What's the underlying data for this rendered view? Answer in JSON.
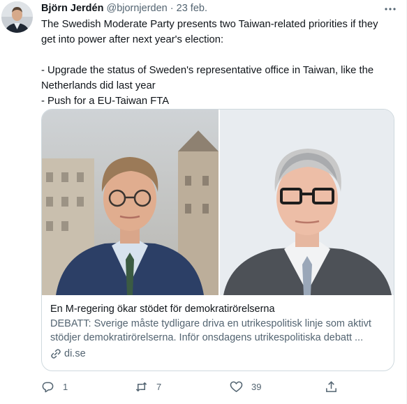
{
  "tweet": {
    "author_name": "Björn Jerdén",
    "author_handle": "@bjornjerden",
    "separator": " · ",
    "date": "23 feb.",
    "lines": [
      "The Swedish Moderate Party presents two Taiwan-related priorities if they get into power after next year's election:",
      "- Upgrade the status of Sweden's representative office in Taiwan, like the Netherlands did last year",
      "- Push for a EU-Taiwan FTA"
    ]
  },
  "card": {
    "title": "En M-regering ökar stödet för demokratirörelserna",
    "description": "DEBATT: Sverige måste tydligare driva en utrikespolitisk linje som aktivt stödjer demokratirörelserna. Inför onsdagens utrikespolitiska debatt ...",
    "domain": "di.se"
  },
  "actions": {
    "replies": "1",
    "retweets": "7",
    "likes": "39"
  },
  "icons": {
    "more": "more-horizontal-icon",
    "reply": "reply-icon",
    "retweet": "retweet-icon",
    "like": "heart-icon",
    "share": "share-icon",
    "link": "link-icon"
  },
  "colors": {
    "text_primary": "#0f1419",
    "text_secondary": "#536471",
    "border": "#cfd9de"
  }
}
